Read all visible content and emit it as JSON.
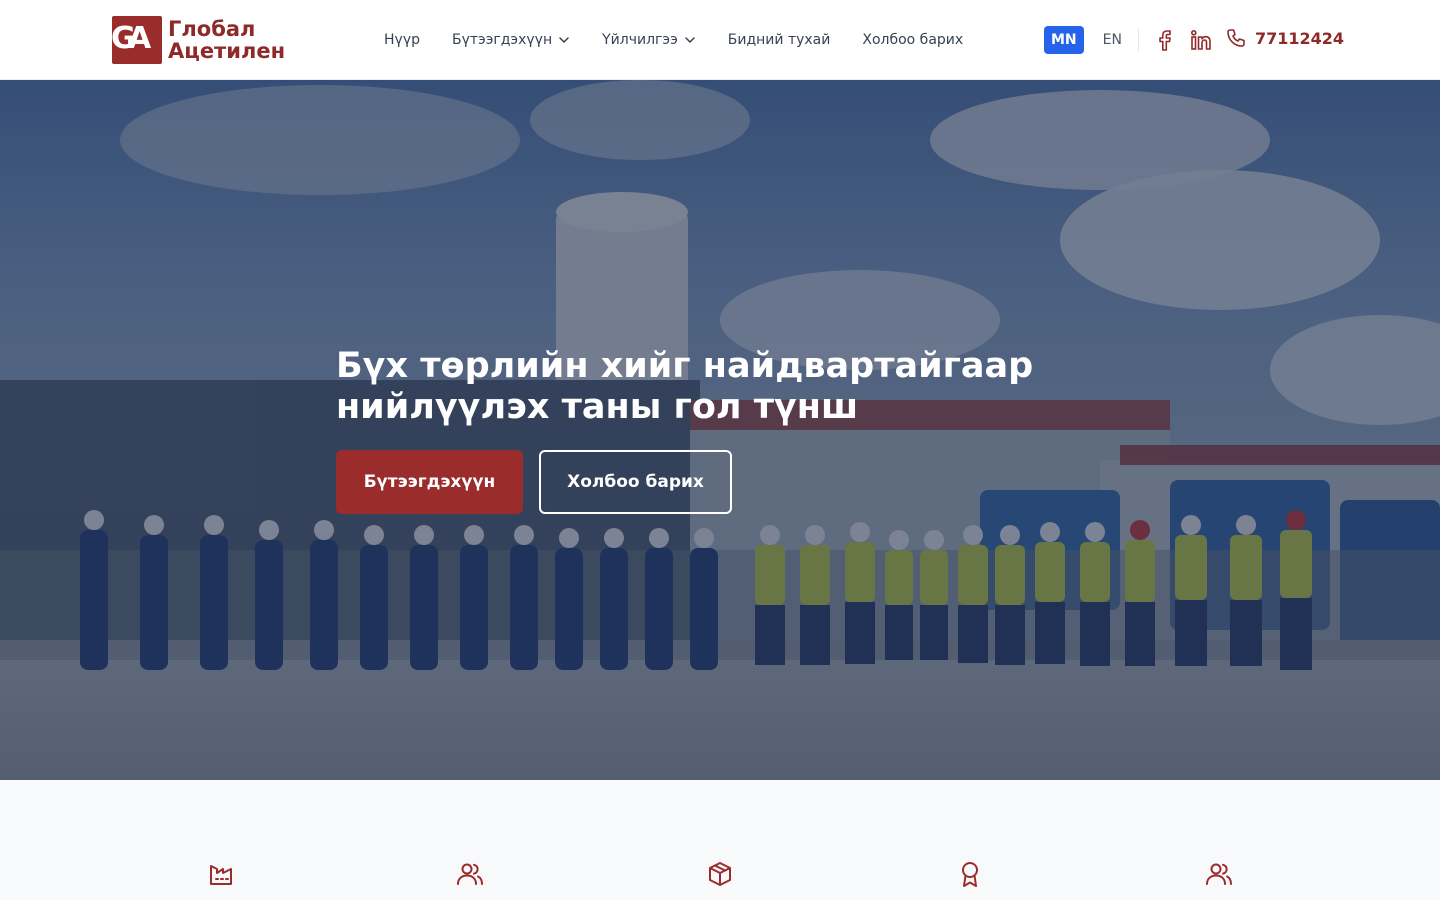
{
  "brand": {
    "logo_letters_1": "G",
    "logo_letters_2": "A",
    "name_line1": "Глобал",
    "name_line2": "Ацетилен",
    "color": "#9b2c2c"
  },
  "nav": {
    "items": [
      {
        "label": "Нүүр",
        "has_dropdown": false
      },
      {
        "label": "Бүтээгдэхүүн",
        "has_dropdown": true
      },
      {
        "label": "Үйлчилгээ",
        "has_dropdown": true
      },
      {
        "label": "Бидний тухай",
        "has_dropdown": false
      },
      {
        "label": "Холбоо барих",
        "has_dropdown": false
      }
    ]
  },
  "language": {
    "active": "MN",
    "other": "EN",
    "active_color": "#2563eb"
  },
  "social": {
    "icons": [
      "facebook-icon",
      "linkedin-icon"
    ]
  },
  "contact": {
    "phone": "77112424",
    "icon": "phone-icon"
  },
  "hero": {
    "title_line1": "Бүх төрлийн хийг найдвартайгаар",
    "title_line2": "нийлүүлэх таны гол түнш",
    "primary_button": "Бүтээгдэхүүн",
    "secondary_button": "Холбоо барих",
    "image_description_icon": "hero-photo"
  },
  "features": {
    "icons": [
      "factory-icon",
      "users-icon",
      "package-icon",
      "award-icon",
      "users-icon"
    ]
  }
}
